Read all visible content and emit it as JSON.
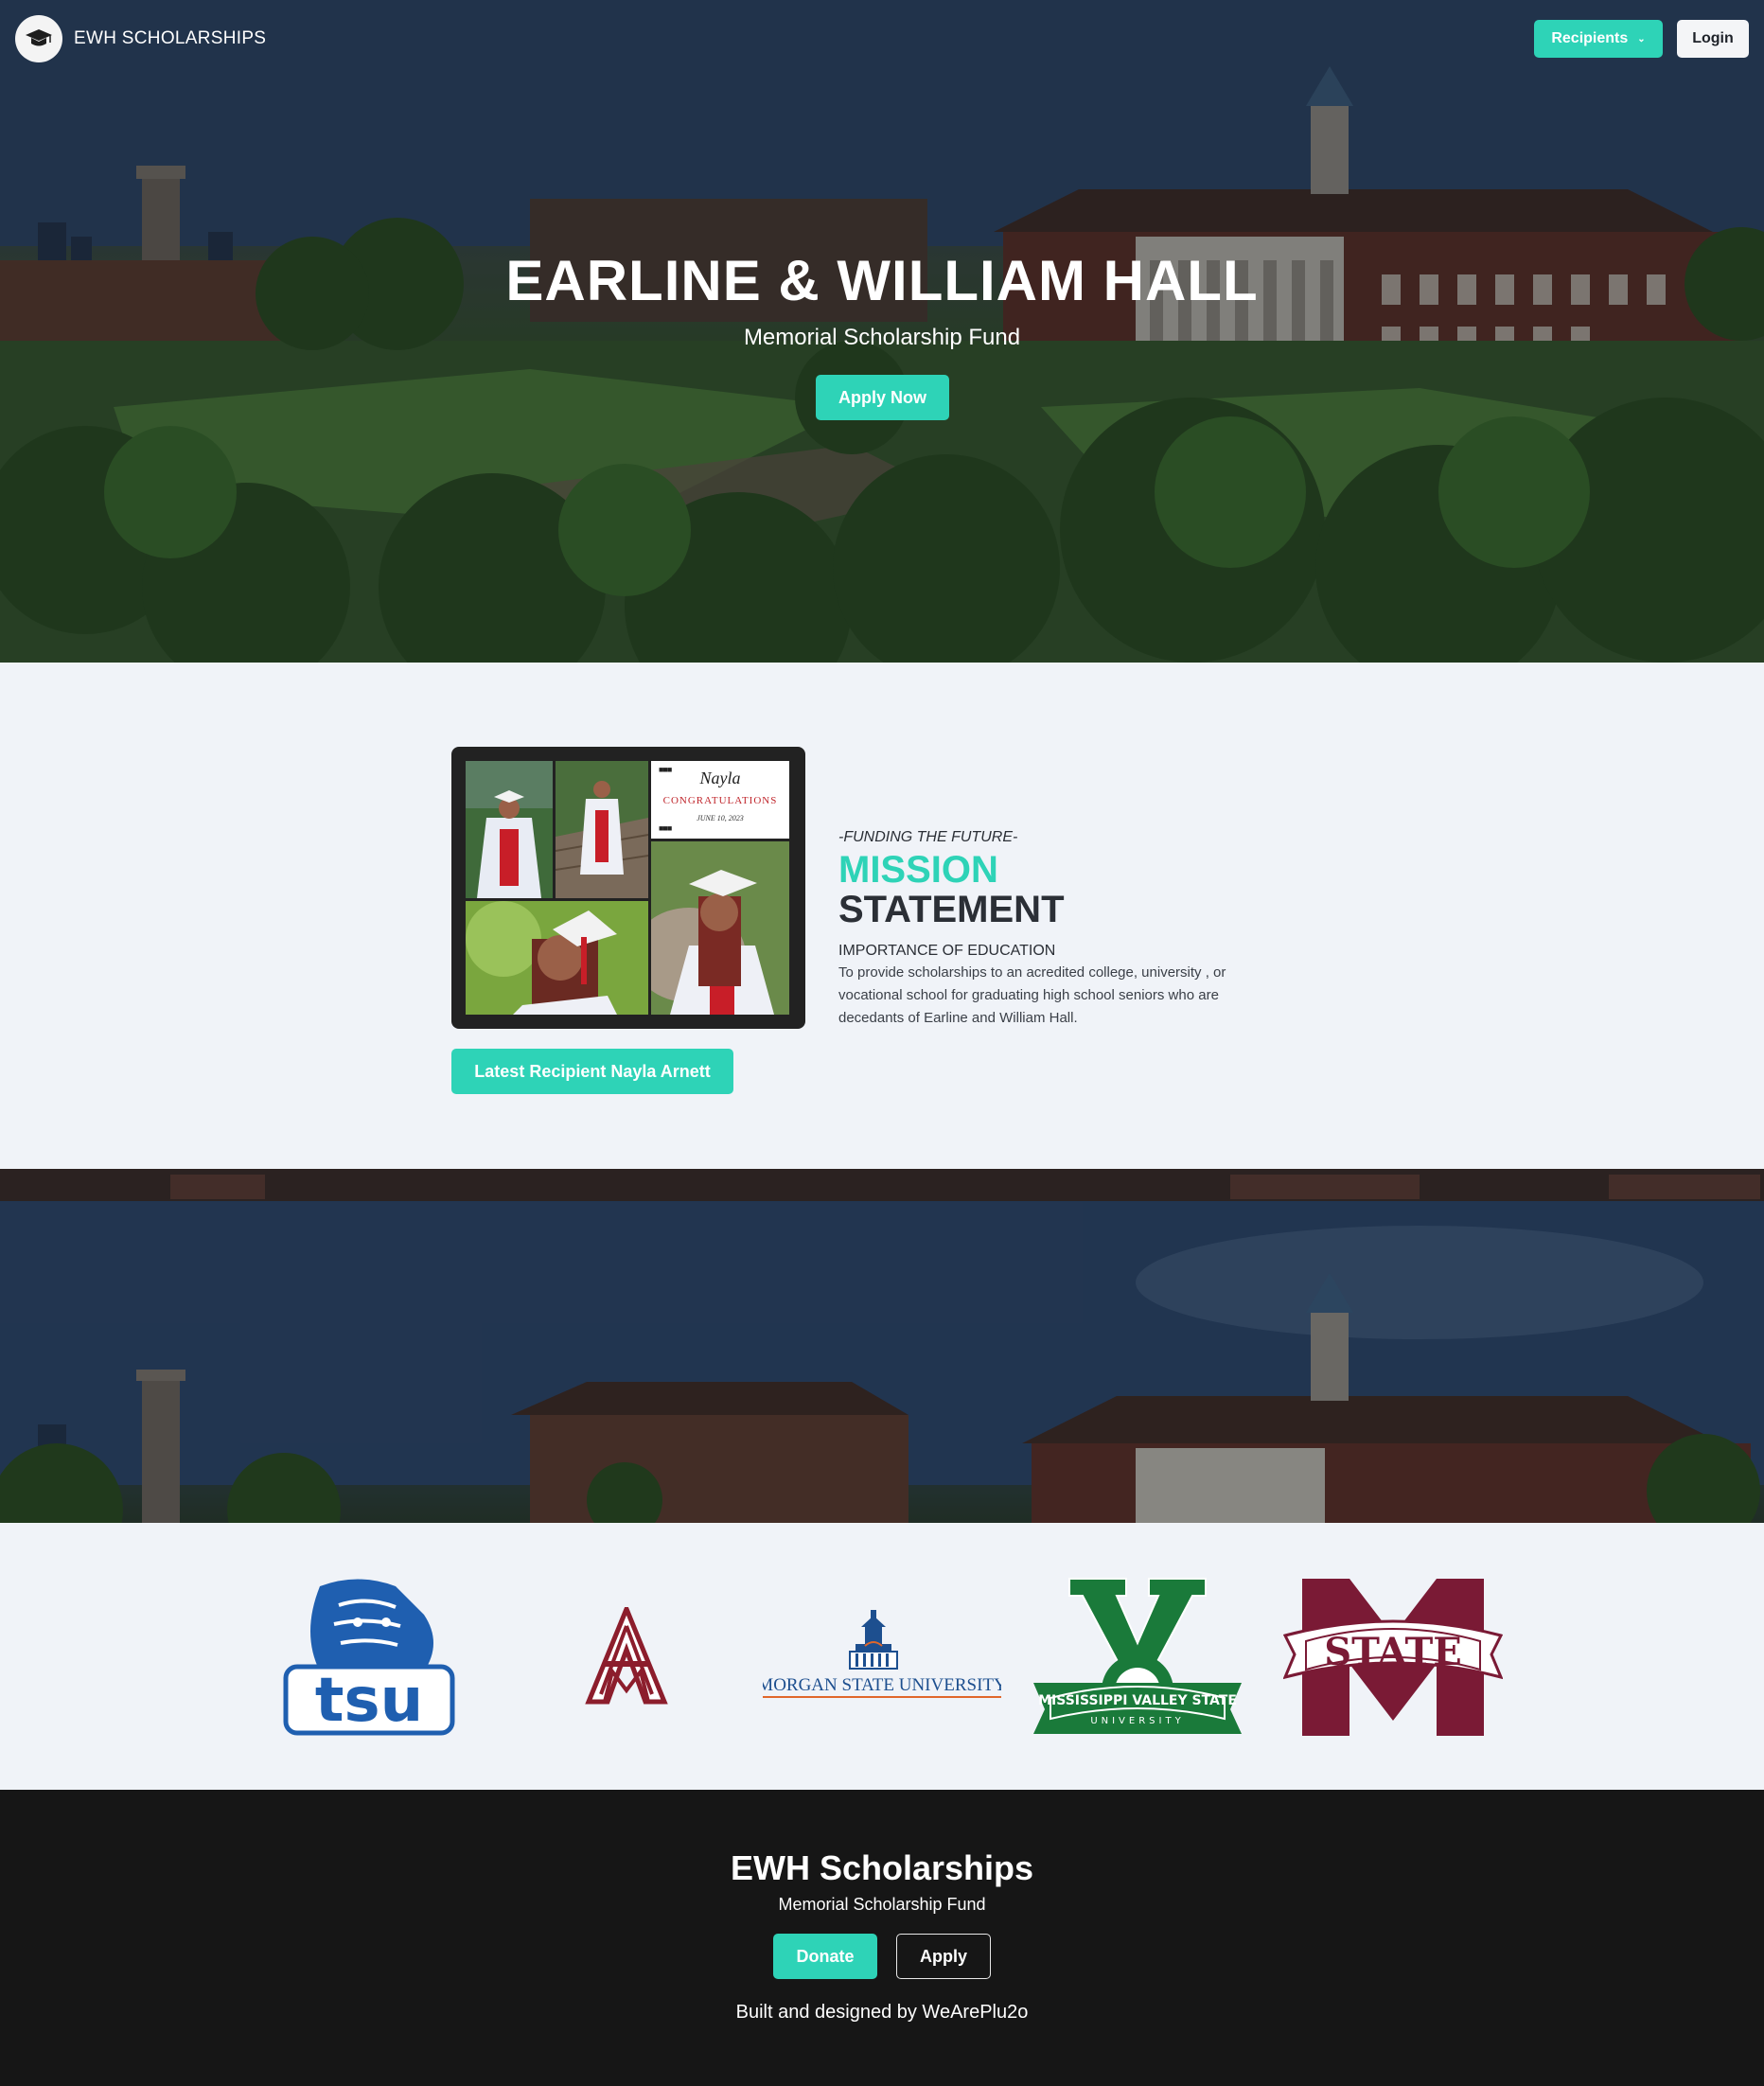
{
  "navbar": {
    "brand_icon": "graduation-cap-icon",
    "brand_text": "EWH SCHOLARSHIPS",
    "recipients_label": "Recipients",
    "recipients_icon": "chevron-down-icon",
    "login_label": "Login"
  },
  "hero": {
    "title": "EARLINE & WILLIAM HALL",
    "subtitle": "Memorial Scholarship Fund",
    "apply_label": "Apply Now"
  },
  "mission": {
    "card": {
      "name": "Nayla",
      "word": "CONGRATULATIONS",
      "date": "JUNE 10, 2023"
    },
    "latest_recipient_label": "Latest Recipient Nayla Arnett",
    "kicker": "-FUNDING THE FUTURE-",
    "title_accent": "MISSION",
    "title_rest": "STATEMENT",
    "heading": "IMPORTANCE OF EDUCATION",
    "body": "To provide scholarships to an acredited college, university , or vocational school for graduating high school seniors who are decedants of Earline and William Hall."
  },
  "logos": {
    "tsu": "tsu",
    "morgan": "MORGAN STATE UNIVERSITY",
    "mvsu_arc": "MISSISSIPPI VALLEY STATE",
    "mvsu_sub": "UNIVERSITY",
    "msstate": "STATE"
  },
  "footer": {
    "title": "EWH Scholarships",
    "subtitle": "Memorial Scholarship Fund",
    "donate_label": "Donate",
    "apply_label": "Apply",
    "credit": "Built and designed by WeArePlu2o"
  },
  "colors": {
    "accent": "#2ed3b7",
    "footer_bg": "#161616",
    "section_bg": "#f0f3f8",
    "tsu_blue": "#1f5fb0",
    "aamu_maroon": "#8c1d2c",
    "morgan_blue": "#1d4f8f",
    "morgan_orange": "#e0672b",
    "mvsu_green": "#1a7a3a",
    "msstate_maroon": "#7a1a35"
  }
}
